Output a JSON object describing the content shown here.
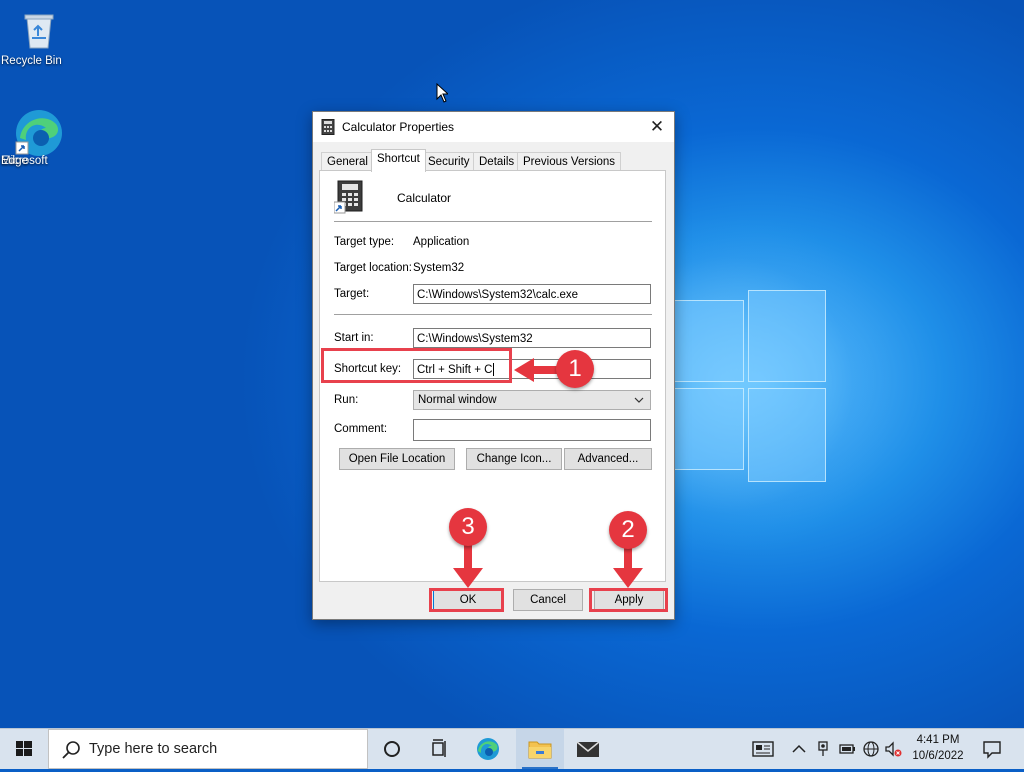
{
  "desktop": {
    "icons": [
      {
        "label": "Recycle Bin"
      },
      {
        "label_line1": "Microsoft",
        "label_line2": "Edge"
      }
    ]
  },
  "dialog": {
    "title": "Calculator Properties",
    "close_glyph": "✕",
    "tabs": [
      "General",
      "Shortcut",
      "Security",
      "Details",
      "Previous Versions"
    ],
    "active_tab": "Shortcut",
    "app_name": "Calculator",
    "target_type_label": "Target type:",
    "target_type_value": "Application",
    "target_location_label": "Target location:",
    "target_location_value": "System32",
    "target_label": "Target:",
    "target_value": "C:\\Windows\\System32\\calc.exe",
    "start_in_label": "Start in:",
    "start_in_value": "C:\\Windows\\System32",
    "shortcut_key_label": "Shortcut key:",
    "shortcut_key_value": "Ctrl + Shift + C",
    "run_label": "Run:",
    "run_value": "Normal window",
    "comment_label": "Comment:",
    "comment_value": "",
    "buttons": {
      "open_file_location": "Open File Location",
      "change_icon": "Change Icon...",
      "advanced": "Advanced...",
      "ok": "OK",
      "cancel": "Cancel",
      "apply": "Apply"
    }
  },
  "annotations": {
    "step1": "1",
    "step2": "2",
    "step3": "3",
    "color": "#e5363f"
  },
  "taskbar": {
    "search_placeholder": "Type here to search",
    "clock_time": "4:41 PM",
    "clock_date": "10/6/2022",
    "icons": [
      "windows-start-icon",
      "search-icon",
      "cortana-icon",
      "task-view-icon",
      "edge-icon",
      "file-explorer-icon",
      "mail-icon"
    ],
    "tray_icons": [
      "news-icon",
      "chevron-up-icon",
      "network-adapter-icon",
      "battery-icon",
      "globe-network-icon",
      "volume-muted-icon",
      "notification-icon"
    ]
  },
  "colors": {
    "desktop_blue": "#0a68d4",
    "taskbar": "#d9e3ee",
    "annotation_red": "#e8414d"
  }
}
